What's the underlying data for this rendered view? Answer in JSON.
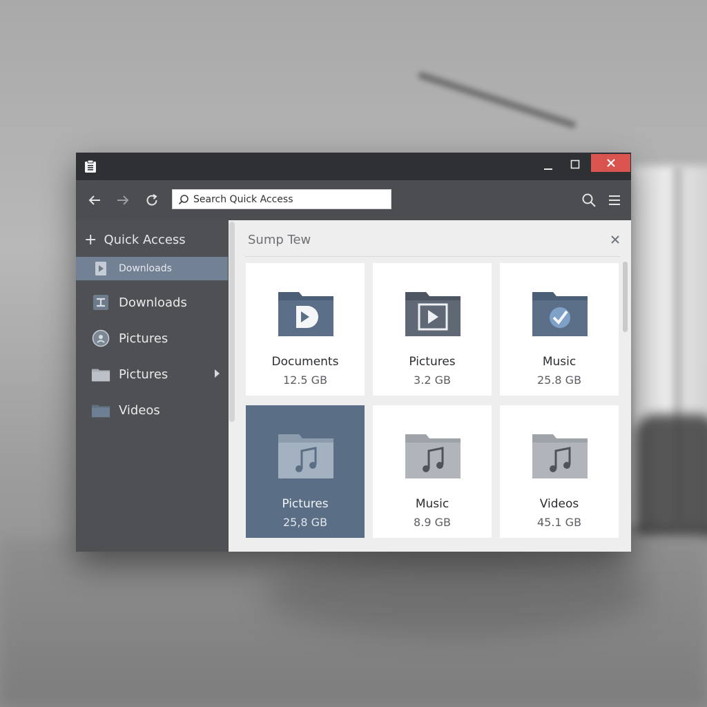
{
  "window": {
    "title_icon": "clipboard-icon",
    "controls": [
      "minimize-icon",
      "maximize-icon",
      "close-icon"
    ],
    "close_color": "#d9534f"
  },
  "toolbar": {
    "search_placeholder": "Search Quick Access"
  },
  "sidebar": {
    "header": "Quick Access",
    "items": [
      {
        "label": "Downloads",
        "icon": "play-document-icon",
        "active": true
      },
      {
        "label": "Downloads",
        "icon": "download-icon",
        "active": false
      },
      {
        "label": "Pictures",
        "icon": "disc-icon",
        "active": false
      },
      {
        "label": "Pictures",
        "icon": "folder-icon",
        "active": false,
        "has_submenu": true
      },
      {
        "label": "Videos",
        "icon": "folder-icon",
        "active": false
      }
    ]
  },
  "content": {
    "header": "Sump Tew",
    "tiles": [
      {
        "name": "Documents",
        "size": "12.5 GB",
        "icon": "play-folder-icon"
      },
      {
        "name": "Pictures",
        "size": "3.2 GB",
        "icon": "video-folder-icon"
      },
      {
        "name": "Music",
        "size": "25.8 GB",
        "icon": "check-folder-icon"
      },
      {
        "name": "Pictures",
        "size": "25,8 GB",
        "icon": "music-folder-icon",
        "selected": true
      },
      {
        "name": "Music",
        "size": "8.9 GB",
        "icon": "music-folder-icon"
      },
      {
        "name": "Videos",
        "size": "45.1 GB",
        "icon": "music-folder-icon"
      }
    ]
  },
  "colors": {
    "selected_tile": "#5a6e85",
    "sidebar_active": "#728194",
    "accent_close": "#d9534f"
  }
}
